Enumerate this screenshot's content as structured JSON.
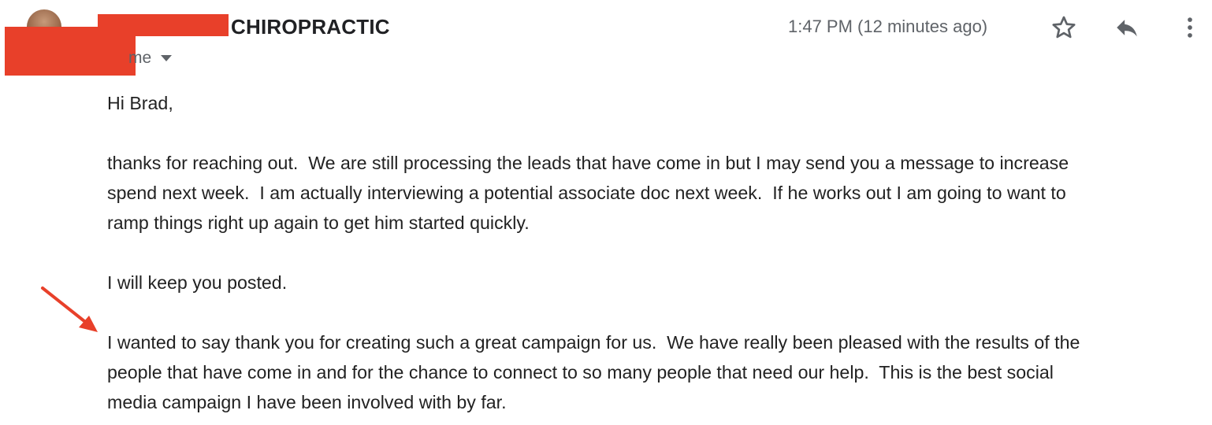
{
  "header": {
    "sender_name": "CHIROPRACTIC",
    "to_label": "me",
    "timestamp": "1:47 PM (12 minutes ago)",
    "icons": {
      "star": "star-icon",
      "reply": "reply-icon",
      "more": "more-vert-icon",
      "recipient_dropdown": "chevron-down-icon"
    }
  },
  "message": {
    "greeting": "Hi Brad,",
    "paragraph_1_line_1": "thanks for reaching out.  We are still processing the leads that have come in but I may send you a message to increase",
    "paragraph_1_line_2": "spend next week.  I am actually interviewing a potential associate doc next week.  If he works out I am going to want to",
    "paragraph_1_line_3": "ramp things right up again to get him started quickly.",
    "paragraph_2": "I will keep you posted.",
    "paragraph_3_line_1": "I wanted to say thank you for creating such a great campaign for us.  We have really been pleased with the results of the",
    "paragraph_3_line_2": "people that have come in and for the chance to connect to so many people that need our help.  This is the best social",
    "paragraph_3_line_3": "media campaign I have been involved with by far."
  },
  "colors": {
    "redaction": "#e8402a",
    "annotation_arrow": "#e8402a",
    "text": "#222222",
    "secondary_text": "#5f6368"
  }
}
